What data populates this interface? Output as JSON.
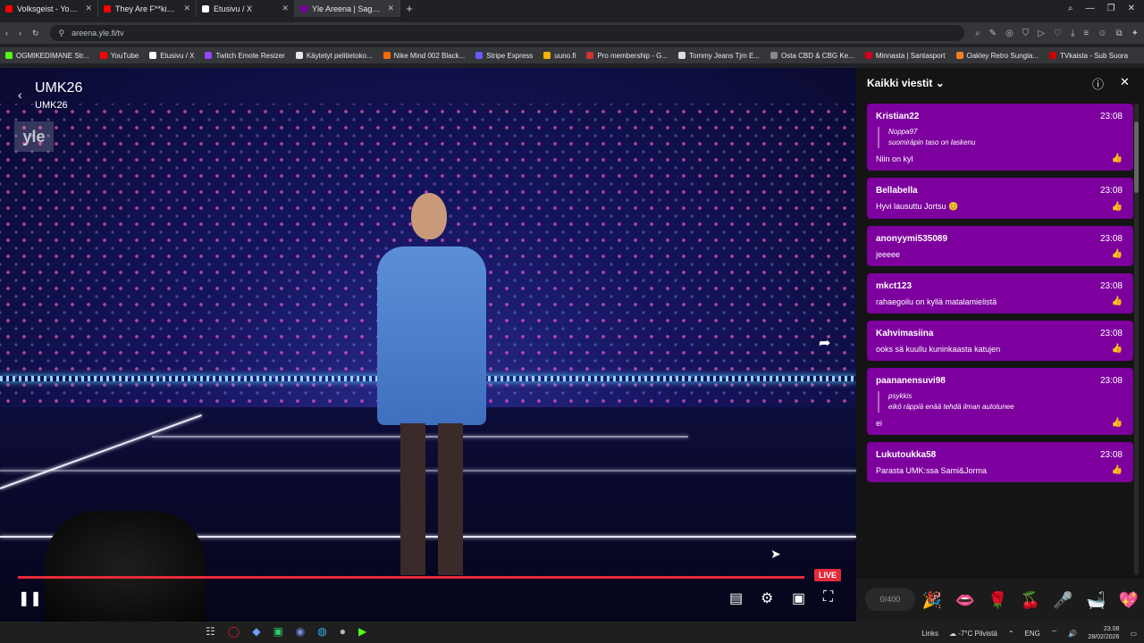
{
  "browser": {
    "tabs": [
      {
        "label": "Volksgeist - YouTube",
        "fav_color": "#ff0000"
      },
      {
        "label": "They Are F**king Panickin",
        "fav_color": "#ff0000"
      },
      {
        "label": "Etusivu / X",
        "fav_color": "#ffffff"
      },
      {
        "label": "Yle Areena | Sagat: Po",
        "fav_color": "#7d009e",
        "active": true
      }
    ],
    "url": "areena.yle.fi/tv",
    "bookmarks": [
      {
        "label": "OGMIKEDIMANE Str...",
        "fav_color": "#53fc18"
      },
      {
        "label": "YouTube",
        "fav_color": "#ff0000"
      },
      {
        "label": "Etusivu / X",
        "fav_color": "#ffffff"
      },
      {
        "label": "Twitch Emote Resizer",
        "fav_color": "#9146ff"
      },
      {
        "label": "Käytetyt pelitietoko...",
        "fav_color": "#e8e8e8"
      },
      {
        "label": "Nike Mind 002 Black...",
        "fav_color": "#ff6a00"
      },
      {
        "label": "Stripe Express",
        "fav_color": "#635bff"
      },
      {
        "label": "uuno.fi",
        "fav_color": "#ffb000"
      },
      {
        "label": "Pro membership - G...",
        "fav_color": "#cc3333"
      },
      {
        "label": "Tommy Jeans Tjm E...",
        "fav_color": "#dddddd"
      },
      {
        "label": "Osta CBD & CBG Ke...",
        "fav_color": "#888888"
      },
      {
        "label": "Minnasta | Santasport",
        "fav_color": "#d0021b"
      },
      {
        "label": "Oakley Retro Sungla...",
        "fav_color": "#f08020"
      },
      {
        "label": "TVkaista - Sub Suora",
        "fav_color": "#cc0000"
      }
    ]
  },
  "player": {
    "title": "UMK26",
    "subtitle": "UMK26",
    "channel_logo": "yle",
    "live_label": "LIVE",
    "icons": [
      "chevron-left-icon",
      "share-icon",
      "pause-icon",
      "subtitles-icon",
      "settings-icon",
      "pip-icon",
      "fullscreen-icon"
    ]
  },
  "chat": {
    "header_title": "Kaikki viestit",
    "messages": [
      {
        "user": "Kristian22",
        "time": "23:08",
        "quote_user": "Noppa97",
        "quote_text": "suomiräpin taso on laskenu",
        "text": "Niin on kyl"
      },
      {
        "user": "Bellabella",
        "time": "23:08",
        "text": "Hyvi lausuttu Jortsu 😊"
      },
      {
        "user": "anonyymi535089",
        "time": "23:08",
        "text": "jeeeee"
      },
      {
        "user": "mkct123",
        "time": "23:08",
        "text": "rahaegoilu on kyllä matalamielistä"
      },
      {
        "user": "Kahvimasiina",
        "time": "23:08",
        "text": "ooks sä kuullu kuninkaasta katujen"
      },
      {
        "user": "paananensuvi98",
        "time": "23:08",
        "quote_user": "psykkis",
        "quote_text": "eikö räppiä enää tehdä ilman autotunee",
        "text": "ei"
      },
      {
        "user": "Lukutoukka58",
        "time": "23:08",
        "text": "Parasta UMK:ssa Sami&Jorma"
      }
    ],
    "counter": "0/400",
    "reactions": [
      "🎉",
      "👄",
      "🌹",
      "🍒",
      "🎤",
      "🛁",
      "💖"
    ]
  },
  "taskbar": {
    "links_label": "Links",
    "weather": "-7°C Pilvistä",
    "lang": "ENG",
    "time": "23.08",
    "date": "28/02/2026"
  }
}
